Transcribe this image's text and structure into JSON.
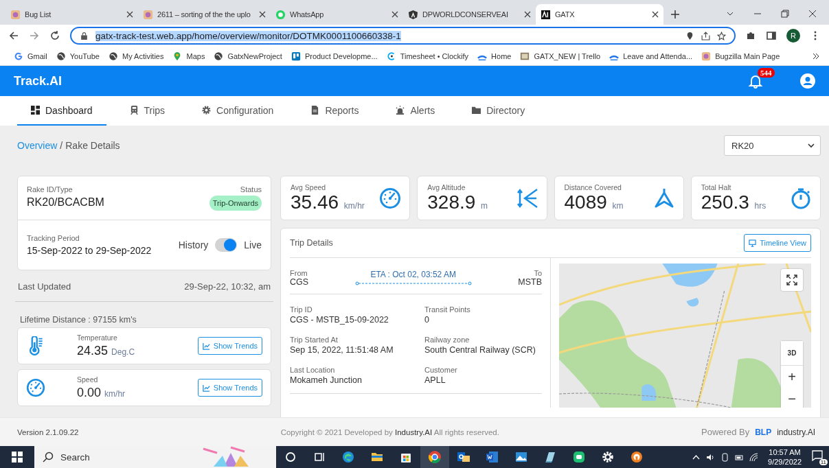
{
  "browser": {
    "tabs": [
      {
        "title": "Bug List",
        "selected": false,
        "kind": "bug"
      },
      {
        "title": "2611 – sorting of the the uplo",
        "selected": false,
        "kind": "bug"
      },
      {
        "title": "WhatsApp",
        "selected": false,
        "kind": "chat"
      },
      {
        "title": "DPWORLDCONSERVEAI",
        "selected": false,
        "kind": "angular"
      },
      {
        "title": "GATX",
        "selected": true,
        "kind": "ai"
      }
    ],
    "address": "gatx-track-test.web.app/home/overview/monitor/DOTMK0001100660338-1",
    "profile": "R",
    "bookmarks": [
      {
        "label": "Gmail",
        "kind": "g"
      },
      {
        "label": "YouTube",
        "kind": "globe"
      },
      {
        "label": "My Activities",
        "kind": "globe"
      },
      {
        "label": "Maps",
        "kind": "pin"
      },
      {
        "label": "GatxNewProject",
        "kind": "globe"
      },
      {
        "label": "Product Developme...",
        "kind": "trello"
      },
      {
        "label": "Timesheet • Clockify",
        "kind": "clock"
      },
      {
        "label": "Home",
        "kind": "blp"
      },
      {
        "label": "GATX_NEW | Trello",
        "kind": "img"
      },
      {
        "label": "Leave and Attenda...",
        "kind": "blp"
      },
      {
        "label": "Bugzilla Main Page",
        "kind": "bug"
      }
    ]
  },
  "app": {
    "brand": "Track.AI",
    "notifications": "544",
    "nav": [
      {
        "label": "Dashboard",
        "selected": true,
        "kind": "grid"
      },
      {
        "label": "Trips",
        "selected": false,
        "kind": "train"
      },
      {
        "label": "Configuration",
        "selected": false,
        "kind": "gear"
      },
      {
        "label": "Reports",
        "selected": false,
        "kind": "doc"
      },
      {
        "label": "Alerts",
        "selected": false,
        "kind": "alarm"
      },
      {
        "label": "Directory",
        "selected": false,
        "kind": "folder"
      }
    ],
    "breadcrumb": {
      "link": "Overview",
      "separator": "/",
      "current": "Rake Details"
    },
    "rake_select": "RK20"
  },
  "rake": {
    "id_label": "Rake ID/Type",
    "id": "RK20/BCACBM",
    "status_label": "Status",
    "status": "Trip-Onwards",
    "period_label": "Tracking Period",
    "period": "15-Sep-2022 to 29-Sep-2022",
    "toggle_left": "History",
    "toggle_right": "Live",
    "live": true,
    "updated_label": "Last Updated",
    "updated": "29-Sep-22, 10:32, am",
    "lifetime": "Lifetime Distance : 97155 km's"
  },
  "sensors": [
    {
      "kind": "temperature",
      "label": "Temperature",
      "value": "24.35",
      "unit": "Deg.C",
      "button": "Show Trends"
    },
    {
      "kind": "speed",
      "label": "Speed",
      "value": "0.00",
      "unit": "km/hr",
      "button": "Show Trends"
    }
  ],
  "stats": [
    {
      "kind": "speed",
      "label": "Avg Speed",
      "value": "35.46",
      "unit": "km/hr"
    },
    {
      "kind": "altitude",
      "label": "Avg Altitude",
      "value": "328.9",
      "unit": "m"
    },
    {
      "kind": "distance",
      "label": "Distance Covered",
      "value": "4089",
      "unit": "km"
    },
    {
      "kind": "halt",
      "label": "Total Halt",
      "value": "250.3",
      "unit": "hrs"
    }
  ],
  "trip": {
    "title": "Trip Details",
    "timeline_button": "Timeline View",
    "from_label": "From",
    "from": "CGS",
    "eta": "ETA : Oct 02, 03:52 AM",
    "to_label": "To",
    "to": "MSTB",
    "fields": [
      {
        "label": "Trip ID",
        "value": "CGS - MSTB_15-09-2022"
      },
      {
        "label": "Transit Points",
        "value": "0"
      },
      {
        "label": "Trip Started At",
        "value": "Sep 15, 2022, 11:51:48 AM"
      },
      {
        "label": "Railway zone",
        "value": "South Central Railway (SCR)"
      },
      {
        "label": "Last Location",
        "value": "Mokameh Junction"
      },
      {
        "label": "Customer",
        "value": "APLL"
      }
    ],
    "map_tilt": "3D",
    "map_zoom_in": "+",
    "map_zoom_out": "−"
  },
  "footer": {
    "version": "Version 2.1.09.22",
    "copyright": "Copyright © 2021 Developed by **Industry.AI** All rights reserved.",
    "powered_by": "Powered By",
    "logo_1": "BLP",
    "logo_2": "industry.AI"
  },
  "taskbar": {
    "search": "Search",
    "time": "10:57 AM",
    "date": "9/29/2022",
    "notifications": "11"
  }
}
